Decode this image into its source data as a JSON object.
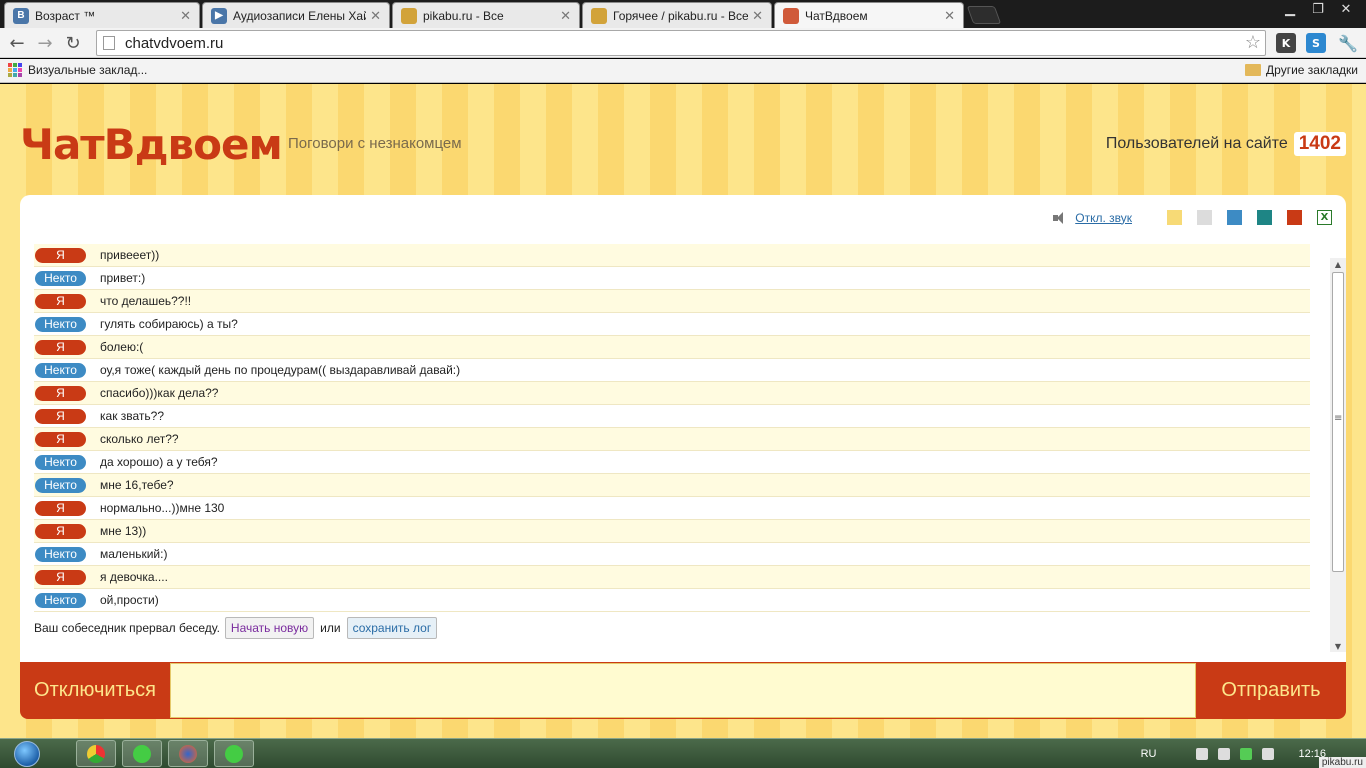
{
  "browser": {
    "tabs": [
      {
        "label": "Возраст ™",
        "icon": "vk-icon",
        "icon_text": "B",
        "icon_color": "#4a76a8"
      },
      {
        "label": "Аудиозаписи Елены Хайб",
        "icon": "play-icon",
        "icon_text": "▶",
        "icon_color": "#4a76a8"
      },
      {
        "label": "pikabu.ru - Все",
        "icon": "pikabu-icon",
        "icon_text": "",
        "icon_color": "#d2a33a"
      },
      {
        "label": "Горячее / pikabu.ru - Все",
        "icon": "pikabu-icon",
        "icon_text": "",
        "icon_color": "#d2a33a"
      },
      {
        "label": "ЧатВдвоем",
        "icon": "chat-icon",
        "icon_text": "",
        "icon_color": "#d05a3a"
      }
    ],
    "address": "chatvdvoem.ru",
    "bookmarks_left": "Визуальные заклад...",
    "bookmarks_right": "Другие закладки"
  },
  "site": {
    "logo": "ЧатВдвоем",
    "tagline": "Поговори с незнакомцем",
    "users_label": "Пользователей на сайте",
    "users_count": "1402",
    "mute_link": "Откл. звук",
    "theme_colors": [
      "#f7da76",
      "#dcdcdc",
      "#3d8bc4",
      "#1e8585",
      "#c93a15"
    ],
    "excel_icon_text": "X"
  },
  "messages": [
    {
      "who": "Я",
      "role": "me",
      "text": "привееет))"
    },
    {
      "who": "Некто",
      "role": "stranger",
      "text": "привет:)"
    },
    {
      "who": "Я",
      "role": "me",
      "text": "что делашеь??!!"
    },
    {
      "who": "Некто",
      "role": "stranger",
      "text": "гулять собираюсь) а ты?"
    },
    {
      "who": "Я",
      "role": "me",
      "text": "болею:("
    },
    {
      "who": "Некто",
      "role": "stranger",
      "text": "оу,я тоже( каждый день по процедурам(( выздаравливай давай:)"
    },
    {
      "who": "Я",
      "role": "me",
      "text": "спасибо)))как дела??"
    },
    {
      "who": "Я",
      "role": "me",
      "text": "как звать??"
    },
    {
      "who": "Я",
      "role": "me",
      "text": "сколько лет??"
    },
    {
      "who": "Некто",
      "role": "stranger",
      "text": "да хорошо) а у тебя?"
    },
    {
      "who": "Некто",
      "role": "stranger",
      "text": "мне 16,тебе?"
    },
    {
      "who": "Я",
      "role": "me",
      "text": "нормально...))мне 130"
    },
    {
      "who": "Я",
      "role": "me",
      "text": "мне 13))"
    },
    {
      "who": "Некто",
      "role": "stranger",
      "text": "маленький:)"
    },
    {
      "who": "Я",
      "role": "me",
      "text": "я девочка...."
    },
    {
      "who": "Некто",
      "role": "stranger",
      "text": "ой,прости)"
    }
  ],
  "ended": {
    "text": "Ваш собеседник прервал беседу.",
    "new_button": "Начать новую",
    "or": "или",
    "save_button": "сохранить лог"
  },
  "input": {
    "disconnect": "Отключиться",
    "send": "Отправить",
    "value": ""
  },
  "taskbar": {
    "lang": "RU",
    "clock": "12:16",
    "watermark": "pikabu.ru"
  }
}
